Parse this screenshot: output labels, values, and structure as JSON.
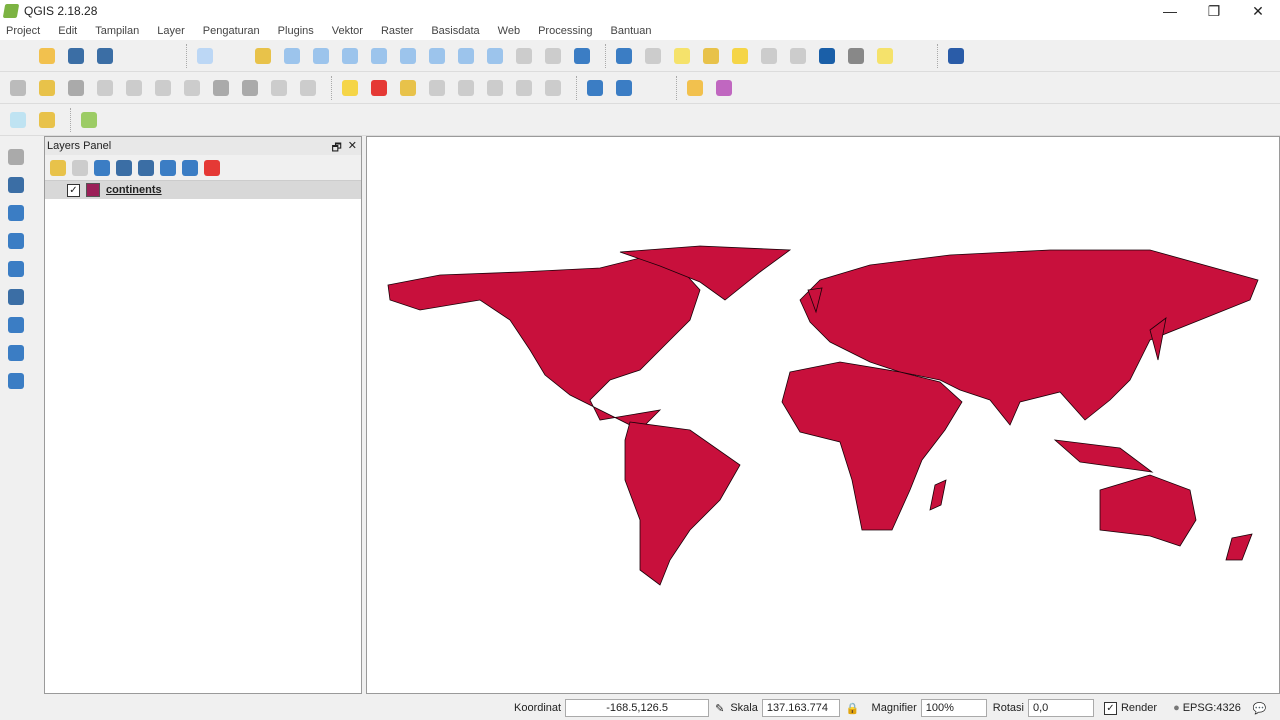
{
  "window": {
    "title": "QGIS 2.18.28",
    "minimize": "—",
    "restore": "❐",
    "close": "✕"
  },
  "menu": [
    "Project",
    "Edit",
    "Tampilan",
    "Layer",
    "Pengaturan",
    "Plugins",
    "Vektor",
    "Raster",
    "Basisdata",
    "Web",
    "Processing",
    "Bantuan"
  ],
  "layers_panel": {
    "title": "Layers Panel",
    "float": "🗗",
    "close": "✕",
    "layers": [
      {
        "name": "continents",
        "checked": "✓",
        "color": "#9b2058"
      }
    ]
  },
  "status": {
    "coord_label": "Koordinat",
    "coord_value": "-168.5,126.5",
    "scale_label": "Skala",
    "scale_value": "137.163.774",
    "magnifier_label": "Magnifier",
    "magnifier_value": "100%",
    "rotation_label": "Rotasi",
    "rotation_value": "0,0",
    "render_label": "Render",
    "render_checked": "✓",
    "crs": "EPSG:4326"
  },
  "colors": {
    "map_fill": "#c8103c",
    "accent": "#3b7dc4"
  }
}
